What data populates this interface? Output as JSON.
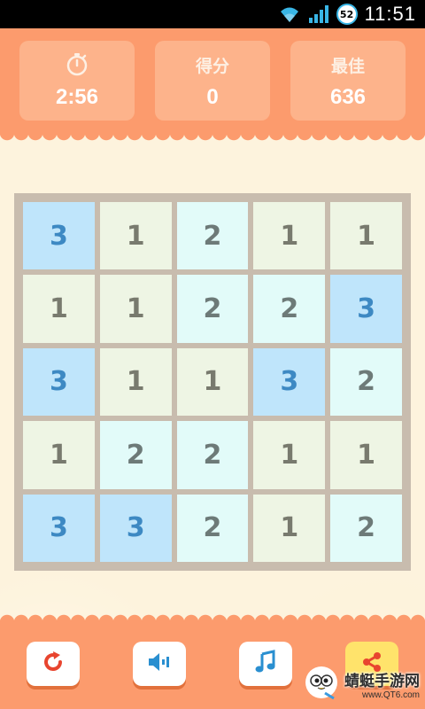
{
  "status_bar": {
    "battery": "52",
    "time": "11:51"
  },
  "header": {
    "timer": {
      "icon": "stopwatch-icon",
      "value": "2:56"
    },
    "score": {
      "label": "得分",
      "value": "0"
    },
    "best": {
      "label": "最佳",
      "value": "636"
    }
  },
  "board": {
    "rows": 5,
    "cols": 5,
    "cells": [
      [
        "3",
        "1",
        "2",
        "1",
        "1"
      ],
      [
        "1",
        "1",
        "2",
        "2",
        "3"
      ],
      [
        "3",
        "1",
        "1",
        "3",
        "2"
      ],
      [
        "1",
        "2",
        "2",
        "1",
        "1"
      ],
      [
        "3",
        "3",
        "2",
        "1",
        "2"
      ]
    ],
    "colors": {
      "1": "#eef5e4",
      "2": "#e2fbf9",
      "3": "#bfe5fb"
    }
  },
  "footer": {
    "buttons": [
      {
        "name": "restart-button",
        "icon": "restart-icon"
      },
      {
        "name": "sound-button",
        "icon": "speaker-icon"
      },
      {
        "name": "music-button",
        "icon": "music-note-icon"
      },
      {
        "name": "share-button",
        "icon": "share-icon"
      }
    ]
  },
  "watermark": {
    "title": "蜻蜓手游网",
    "site": "www.QT6.com"
  },
  "colors": {
    "header": "#fc9b6d",
    "stat_box": "#fdb38b",
    "board_frame": "#c8bcae",
    "background": "#fdf3dd",
    "accent_red": "#e8452f",
    "accent_blue": "#2a8fd0"
  }
}
